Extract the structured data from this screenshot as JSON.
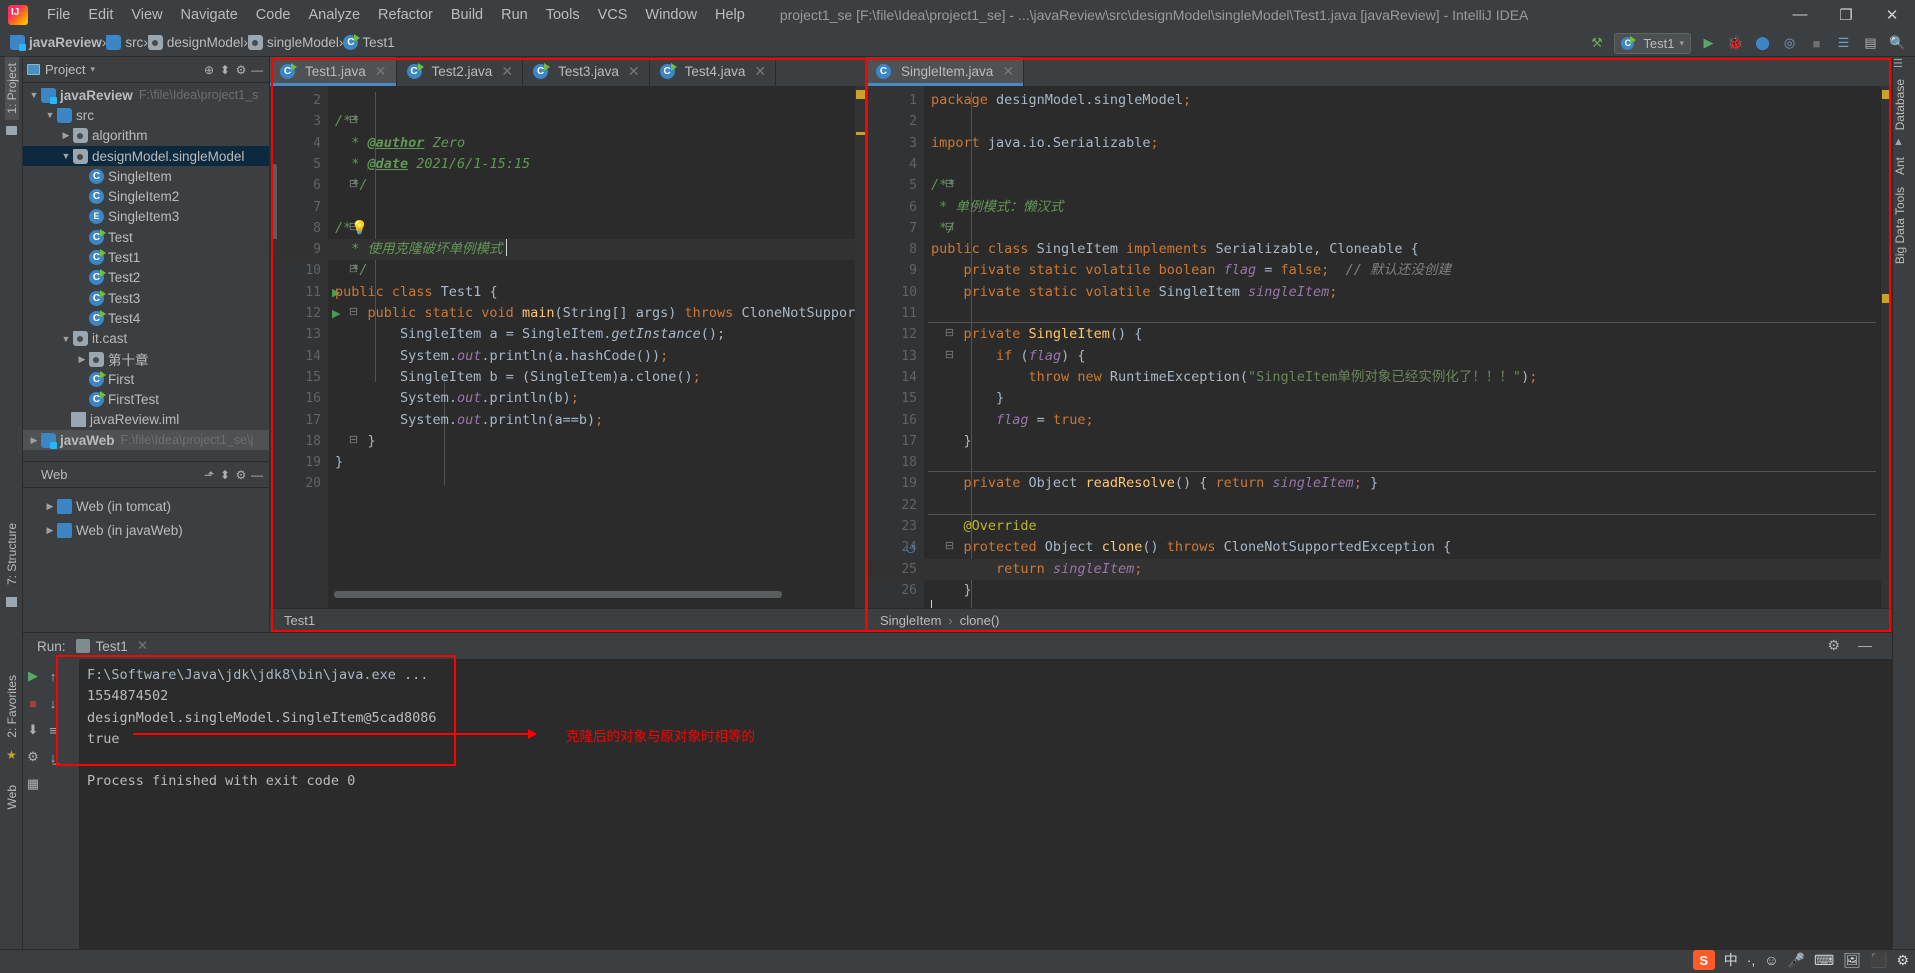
{
  "titlebar": {
    "menus": [
      "File",
      "Edit",
      "View",
      "Navigate",
      "Code",
      "Analyze",
      "Refactor",
      "Build",
      "Run",
      "Tools",
      "VCS",
      "Window",
      "Help"
    ],
    "window_title": "project1_se [F:\\file\\Idea\\project1_se] - ...\\javaReview\\src\\designModel\\singleModel\\Test1.java [javaReview] - IntelliJ IDEA",
    "minimize": "—",
    "maximize": "❐",
    "close": "✕"
  },
  "navbar": {
    "crumbs": [
      {
        "label": "javaReview",
        "icon": "folder-module-icon"
      },
      {
        "label": "src",
        "icon": "folder-source-icon"
      },
      {
        "label": "designModel",
        "icon": "folder-package-icon"
      },
      {
        "label": "singleModel",
        "icon": "folder-package-icon"
      },
      {
        "label": "Test1",
        "icon": "java-class-icon"
      }
    ],
    "separator": "›",
    "run_config": "Test1",
    "icons": {
      "build_hammer": "⚒",
      "run": "▶",
      "debug": "🐞",
      "run_coverage": "⬤",
      "profile": "◎",
      "stop": "■",
      "update": "☰",
      "layout": "▤",
      "search": "🔍",
      "chevron": "▾"
    }
  },
  "left_strip": {
    "project": "1: Project",
    "structure": "7: Structure",
    "favorites": "2: Favorites",
    "web": "Web"
  },
  "right_strip": {
    "database": "Database",
    "ant": "Ant",
    "bigdata": "Big Data Tools"
  },
  "project_panel": {
    "title": "Project",
    "chevron": "▾",
    "icons": {
      "locate": "⊕",
      "collapse": "⬍",
      "gear": "⚙",
      "minimize": "—"
    },
    "tree": [
      {
        "depth": 0,
        "arrow": "▼",
        "label": "javaReview",
        "path": "F:\\file\\Idea\\project1_s",
        "icon": "folder-module-icon",
        "bold": true
      },
      {
        "depth": 1,
        "arrow": "▼",
        "label": "src",
        "icon": "folder-source-icon"
      },
      {
        "depth": 2,
        "arrow": "▶",
        "label": "algorithm",
        "icon": "folder-package-icon"
      },
      {
        "depth": 2,
        "arrow": "▼",
        "label": "designModel.singleModel",
        "icon": "folder-package-icon",
        "selected": true
      },
      {
        "depth": 3,
        "arrow": "",
        "label": "SingleItem",
        "icon": "java-class-icon"
      },
      {
        "depth": 3,
        "arrow": "",
        "label": "SingleItem2",
        "icon": "java-class-icon"
      },
      {
        "depth": 3,
        "arrow": "",
        "label": "SingleItem3",
        "icon": "java-enum-icon"
      },
      {
        "depth": 3,
        "arrow": "",
        "label": "Test",
        "icon": "java-runnable-class-icon"
      },
      {
        "depth": 3,
        "arrow": "",
        "label": "Test1",
        "icon": "java-runnable-class-icon"
      },
      {
        "depth": 3,
        "arrow": "",
        "label": "Test2",
        "icon": "java-runnable-class-icon"
      },
      {
        "depth": 3,
        "arrow": "",
        "label": "Test3",
        "icon": "java-runnable-class-icon"
      },
      {
        "depth": 3,
        "arrow": "",
        "label": "Test4",
        "icon": "java-runnable-class-icon"
      },
      {
        "depth": 2,
        "arrow": "▼",
        "label": "it.cast",
        "icon": "folder-package-icon"
      },
      {
        "depth": 3,
        "arrow": "▶",
        "label": "第十章",
        "icon": "folder-package-icon"
      },
      {
        "depth": 3,
        "arrow": "",
        "label": "First",
        "icon": "java-runnable-class-icon"
      },
      {
        "depth": 3,
        "arrow": "",
        "label": "FirstTest",
        "icon": "java-runnable-class-icon"
      },
      {
        "depth": 1,
        "arrow": "",
        "label": "javaReview.iml",
        "icon": "iml-file-icon"
      },
      {
        "depth": 0,
        "arrow": "▶",
        "label": "javaWeb",
        "path": "F:\\file\\Idea\\project1_se\\j",
        "icon": "folder-module-icon",
        "bold": true,
        "hover": true
      }
    ]
  },
  "web_panel": {
    "title": "Web",
    "icons": {
      "expand": "⬏",
      "collapse": "⬍",
      "gear": "⚙",
      "minimize": "—"
    },
    "items": [
      {
        "arrow": "▶",
        "label": "Web (in tomcat)"
      },
      {
        "arrow": "▶",
        "label": "Web (in javaWeb)"
      }
    ]
  },
  "editor_left": {
    "tabs": [
      {
        "label": "Test1.java",
        "active": true,
        "close": "✕"
      },
      {
        "label": "Test2.java",
        "active": false,
        "close": "✕"
      },
      {
        "label": "Test3.java",
        "active": false,
        "close": "✕"
      },
      {
        "label": "Test4.java",
        "active": false,
        "close": "✕"
      }
    ],
    "first_line_number": 2,
    "lines": [
      {
        "n": 2,
        "html": ""
      },
      {
        "n": 3,
        "html": "<span class='cmt'>/**</span>",
        "fold": "⊟"
      },
      {
        "n": 4,
        "html": "  <span class='cmt'>* </span><span class='tag'>@author</span><span class='cmt'> Zero</span>"
      },
      {
        "n": 5,
        "html": "  <span class='cmt'>* </span><span class='tag'>@date</span><span class='cmt'> 2021/6/1-15:15</span>"
      },
      {
        "n": 6,
        "html": "  <span class='cmt'>*/</span>",
        "fold": "⊟"
      },
      {
        "n": 7,
        "html": ""
      },
      {
        "n": 8,
        "html": "<span class='cmt'>/*</span>💡",
        "fold": "⊟"
      },
      {
        "n": 9,
        "html": "  <span class='cmt'>* 使用克隆破坏单例模式</span>",
        "current": true
      },
      {
        "n": 10,
        "html": "  <span class='cmt'>*/</span>",
        "fold": "⊟"
      },
      {
        "n": 11,
        "html": "<span class='kw'>public class </span><span class='typ'>Test1 </span>{",
        "run": true
      },
      {
        "n": 12,
        "html": "    <span class='kw'>public static void </span><span class='mth'>main</span>(<span class='typ'>String</span>[] args) <span class='kw'>throws </span><span class='typ'>CloneNotSupportedExcep</span>",
        "run": true,
        "fold": "⊟"
      },
      {
        "n": 13,
        "html": "        <span class='typ'>SingleItem</span> a = <span class='typ'>SingleItem</span>.<span class='mthi'>getInstance</span>();"
      },
      {
        "n": 14,
        "html": "        <span class='typ'>System</span>.<span class='fld'>out</span>.println(a.hashCode())<span class='kw'>;</span>"
      },
      {
        "n": 15,
        "html": "        <span class='typ'>SingleItem</span> b = (<span class='typ'>SingleItem</span>)a.clone()<span class='kw'>;</span>"
      },
      {
        "n": 16,
        "html": "        <span class='typ'>System</span>.<span class='fld'>out</span>.println(b)<span class='kw'>;</span>"
      },
      {
        "n": 17,
        "html": "        <span class='typ'>System</span>.<span class='fld'>out</span>.println(a==b)<span class='kw'>;</span>"
      },
      {
        "n": 18,
        "html": "    }",
        "fold": "⊟"
      },
      {
        "n": 19,
        "html": "}"
      },
      {
        "n": 20,
        "html": ""
      }
    ],
    "status_breadcrumb": [
      "Test1"
    ]
  },
  "editor_right": {
    "tabs": [
      {
        "label": "SingleItem.java",
        "active": true,
        "close": "✕"
      }
    ],
    "lines": [
      {
        "n": 1,
        "html": "<span class='kw'>package </span><span class='typ'>designModel.singleModel</span><span class='kw'>;</span>"
      },
      {
        "n": 2,
        "html": ""
      },
      {
        "n": 3,
        "html": "<span class='kw'>import </span><span class='typ'>java.io.Serializable</span><span class='kw'>;</span>"
      },
      {
        "n": 4,
        "html": ""
      },
      {
        "n": 5,
        "html": "<span class='cmt'>/**</span>",
        "fold": "⊟"
      },
      {
        "n": 6,
        "html": " <span class='cmt'>* 单例模式：懒汉式</span>"
      },
      {
        "n": 7,
        "html": " <span class='cmt'>*/</span>",
        "fold": "⊟"
      },
      {
        "n": 8,
        "html": "<span class='kw'>public class </span><span class='typ'>SingleItem </span><span class='kw'>implements </span><span class='typ'>Serializable</span>, <span class='typ'>Cloneable </span>{"
      },
      {
        "n": 9,
        "html": "    <span class='kw'>private static volatile boolean </span><span class='fld'>flag </span>= <span class='kw'>false</span><span class='kw'>;</span>  <span class='cmtl'>// 默认还没创建</span>"
      },
      {
        "n": 10,
        "html": "    <span class='kw'>private static volatile </span><span class='typ'>SingleItem </span><span class='fld'>singleItem</span><span class='kw'>;</span>"
      },
      {
        "n": 11,
        "html": ""
      },
      {
        "n": 12,
        "html": "    <span class='kw'>private </span><span class='mth'>SingleItem</span>() {",
        "fold": "⊟",
        "sep_above": true
      },
      {
        "n": 13,
        "html": "        <span class='kw'>if </span>(<span class='fld'>flag</span>) {",
        "fold": "⊟"
      },
      {
        "n": 14,
        "html": "            <span class='kw'>throw new </span><span class='typ'>RuntimeException</span>(<span class='str'>\"SingleItem单例对象已经实例化了！！！\"</span>)<span class='kw'>;</span>"
      },
      {
        "n": 15,
        "html": "        }"
      },
      {
        "n": 16,
        "html": "        <span class='fld'>flag </span>= <span class='kw'>true;</span>"
      },
      {
        "n": 17,
        "html": "    }"
      },
      {
        "n": 18,
        "html": ""
      },
      {
        "n": 19,
        "html": "    <span class='kw'>private </span><span class='typ'>Object </span><span class='mth'>readResolve</span>() { <span class='kw'>return </span><span class='fld'>singleItem</span><span class='kw'>; </span>}",
        "sep_above": true
      },
      {
        "n": 22,
        "html": ""
      },
      {
        "n": 23,
        "html": "    <span class='annot'>@Override</span>",
        "sep_above": true
      },
      {
        "n": 24,
        "html": "    <span class='kw'>protected </span><span class='typ'>Object </span><span class='mth'>clone</span>() <span class='kw'>throws </span><span class='typ'>CloneNotSupportedException </span>{",
        "fold": "⊟",
        "override": true
      },
      {
        "n": 25,
        "html": "        <span class='kw'>return </span><span class='fld'>singleItem</span><span class='kw'>;</span>",
        "current": true
      },
      {
        "n": 26,
        "html": "    }"
      }
    ],
    "status_breadcrumb": [
      "SingleItem",
      "clone()"
    ]
  },
  "run_panel": {
    "label": "Run:",
    "tab": "Test1",
    "close": "✕",
    "gear": "⚙",
    "minimize": "—",
    "tool_icons": [
      "▶",
      "■",
      "⬇",
      "↑",
      "↓",
      "≡",
      "⚙",
      "▦",
      "↓̲"
    ],
    "console_lines": [
      "F:\\Software\\Java\\jdk\\jdk8\\bin\\java.exe ...",
      "1554874502",
      "designModel.singleModel.SingleItem@5cad8086",
      "true",
      "",
      "Process finished with exit code 0"
    ],
    "annotation": "克隆后的对象与原对象时相等的"
  },
  "status_bar": {
    "tray": [
      "中",
      "·,",
      "☺",
      "🎤",
      "⌨",
      "🖼",
      "⬛",
      "⚙"
    ],
    "sogou": "S"
  },
  "colors": {
    "accent": "#4a88c7",
    "annotation_red": "#fe0000",
    "editor_bg": "#2b2b2b",
    "panel_bg": "#3c3f41",
    "selection_blue": "#0d293e"
  }
}
